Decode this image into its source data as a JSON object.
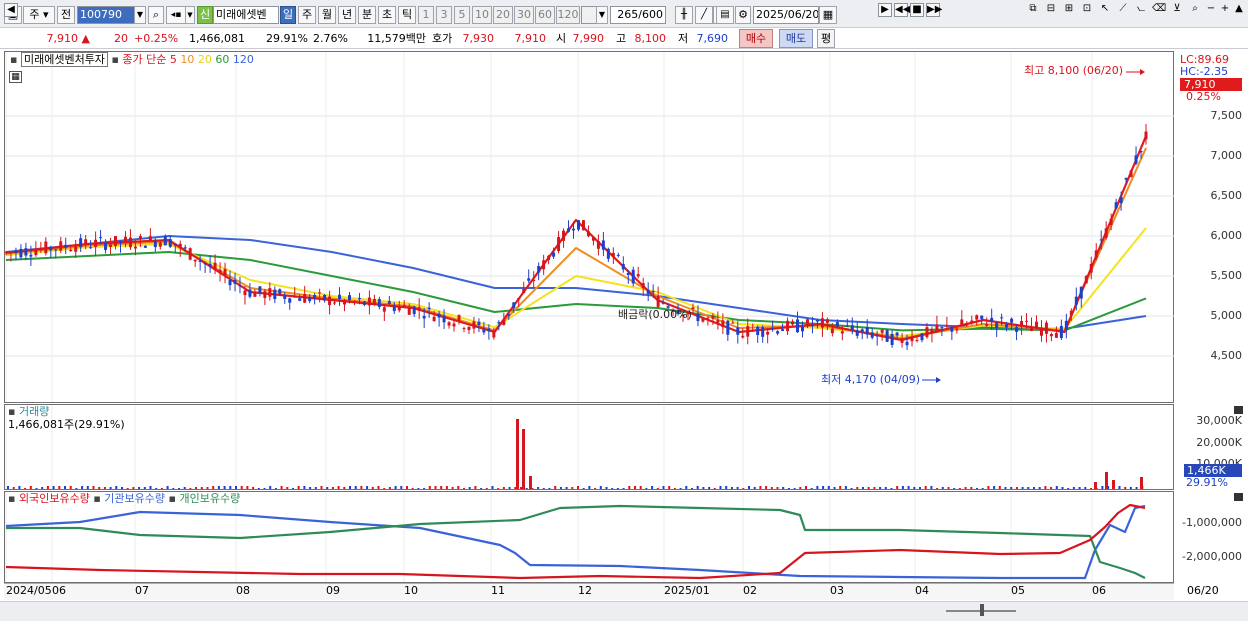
{
  "toolbar": {
    "market_select": "주",
    "stock_type": "전",
    "stock_code": "100790",
    "stock_name": "미래에셋벤",
    "new_badge": "신",
    "periods": [
      "일",
      "주",
      "월",
      "년",
      "분",
      "초",
      "틱"
    ],
    "period_selected": "일",
    "intervals": [
      "1",
      "3",
      "5",
      "10",
      "20",
      "30",
      "60",
      "120"
    ],
    "count": "265",
    "count_max": "/600",
    "date": "2025/06/20"
  },
  "quote": {
    "price": "7,910",
    "change": "20",
    "change_pct": "+0.25%",
    "volume": "1,466,081",
    "turnover_pct": "29.91%",
    "ratio": "2.76%",
    "amount": "11,579백만",
    "ask_label": "호가",
    "ask": "7,930",
    "bid": "7,910",
    "open_label": "시",
    "open": "7,990",
    "high_label": "고",
    "high": "8,100",
    "low_label": "저",
    "low": "7,690",
    "buy_button": "매수",
    "sell_button": "매도",
    "avg_button": "평"
  },
  "price_panel": {
    "title": "미래에셋벤처투자",
    "ma_label": "종가 단순",
    "ma_periods": [
      "5",
      "10",
      "20",
      "60",
      "120"
    ],
    "lc": "LC:89.69",
    "hc": "HC:-2.35",
    "current_price_tag": "7,910",
    "current_pct_tag": "0.25%",
    "high_annotation": "최고 8,100 (06/20)",
    "low_annotation": "최저 4,170 (04/09)",
    "ref_annotation": "배금락(0.00%)",
    "y_ticks": [
      "7,500",
      "7,000",
      "6,500",
      "6,000",
      "5,500",
      "5,000",
      "4,500"
    ]
  },
  "volume_panel": {
    "title": "거래량",
    "value": "1,466,081주(29.91%)",
    "y_ticks": [
      "30,000K",
      "20,000K",
      "10,000K"
    ],
    "current_tag": "1,466K",
    "current_pct": "29.91%"
  },
  "holdings_panel": {
    "series": [
      "외국인보유수량",
      "기관보유수량",
      "개인보유수량"
    ],
    "y_ticks": [
      "-1,000,000",
      "-2,000,000"
    ]
  },
  "x_axis": {
    "labels": [
      "2024/05",
      "06",
      "07",
      "08",
      "09",
      "10",
      "11",
      "12",
      "2025/01",
      "02",
      "03",
      "04",
      "05",
      "06"
    ],
    "right_label": "06/20"
  },
  "colors": {
    "up": "#d8141e",
    "down": "#1d3fcb",
    "ma5": "#e01b1b",
    "ma10": "#f08c1e",
    "ma20": "#f5e21e",
    "ma60": "#2a9a3a",
    "ma120": "#3a63d8",
    "foreign": "#d8141e",
    "institution": "#3a63d8",
    "individual": "#2e8b57"
  },
  "chart_data": {
    "type": "line",
    "title": "미래에셋벤처투자",
    "x": [
      "2024/05",
      "06",
      "07",
      "08",
      "09",
      "10",
      "11",
      "12",
      "2025/01",
      "02",
      "03",
      "04",
      "05",
      "06"
    ],
    "ylim": [
      4170,
      8100
    ],
    "series": [
      {
        "name": "5",
        "values": [
          5790,
          5900,
          5950,
          5300,
          5200,
          5100,
          4800,
          6200,
          5200,
          4800,
          4900,
          4700,
          4950,
          4800,
          7250
        ]
      },
      {
        "name": "10",
        "values": [
          5780,
          5880,
          5930,
          5350,
          5220,
          5120,
          4820,
          5850,
          5250,
          4850,
          4880,
          4720,
          4900,
          4820,
          7100
        ]
      },
      {
        "name": "20",
        "values": [
          5760,
          5860,
          5900,
          5450,
          5250,
          5150,
          4860,
          5500,
          5300,
          4900,
          4850,
          4750,
          4880,
          4840,
          6100
        ]
      },
      {
        "name": "60",
        "values": [
          5700,
          5750,
          5800,
          5700,
          5500,
          5300,
          5050,
          5150,
          5100,
          4950,
          4900,
          4820,
          4840,
          4820,
          5220
        ]
      },
      {
        "name": "120",
        "values": [
          5800,
          5900,
          6000,
          5950,
          5800,
          5600,
          5350,
          5350,
          5250,
          5100,
          4950,
          4900,
          4860,
          4840,
          5000
        ]
      }
    ]
  }
}
